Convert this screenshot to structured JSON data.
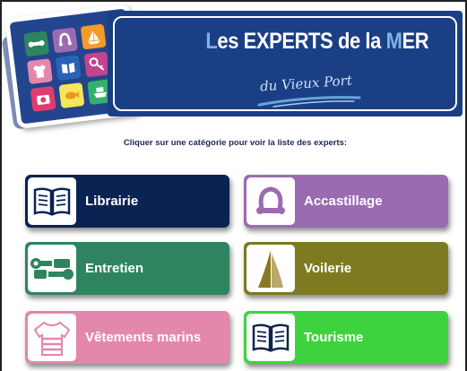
{
  "header": {
    "title_l1": "L",
    "title_l2": "es EXPERTS de la ",
    "title_m": "M",
    "title_end": "ER",
    "subtitle": "du Vieux Port"
  },
  "instruction": "Cliquer sur une catégorie pour voir la liste des experts:",
  "categories": [
    {
      "label": "Librairie",
      "color": "#0b2352",
      "icon": "book-icon"
    },
    {
      "label": "Accastillage",
      "color": "#9b6bb2",
      "icon": "shackle-icon"
    },
    {
      "label": "Entretien",
      "color": "#2f8460",
      "icon": "wrench-icon"
    },
    {
      "label": "Voilerie",
      "color": "#7d7a22",
      "icon": "sail-icon"
    },
    {
      "label": "Vêtements marins",
      "color": "#e387ad",
      "icon": "shirt-icon"
    },
    {
      "label": "Tourisme",
      "color": "#3fd23f",
      "icon": "book-icon"
    }
  ],
  "colors": {
    "banner": "#1b3f84",
    "accent_letters": "#7fb2e8"
  }
}
